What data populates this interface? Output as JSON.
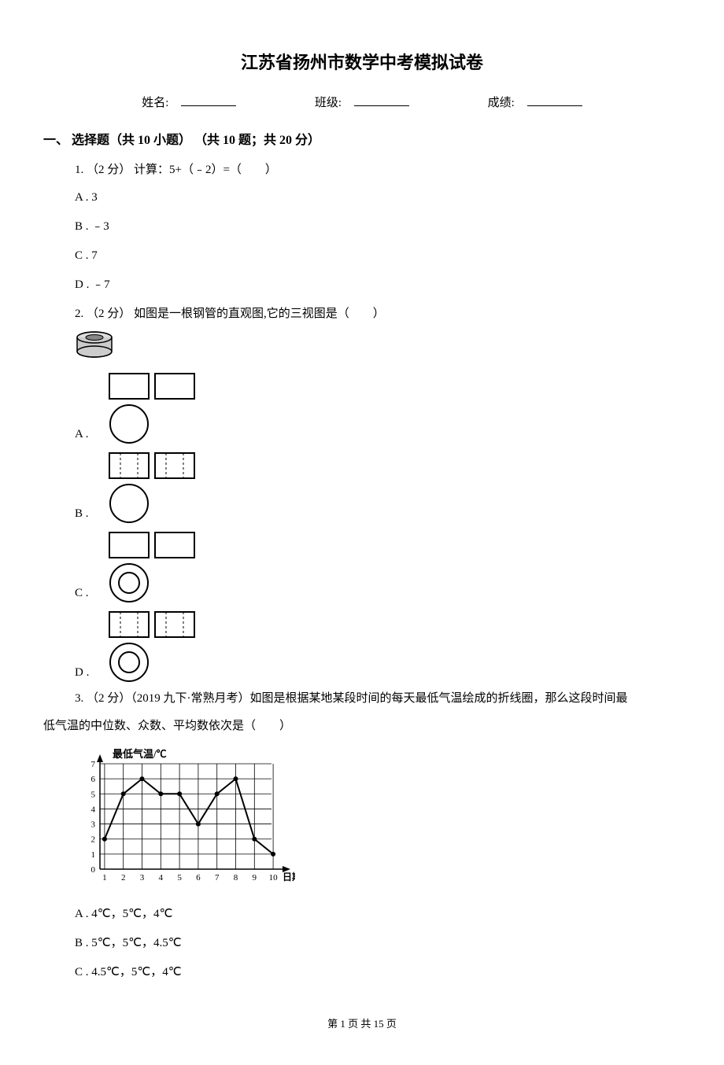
{
  "title": "江苏省扬州市数学中考模拟试卷",
  "header": {
    "name_label": "姓名:",
    "class_label": "班级:",
    "score_label": "成绩:"
  },
  "section1": {
    "heading": "一、 选择题（共 10 小题） （共 10 题；共 20 分）"
  },
  "q1": {
    "text": "1. （2 分） 计算：5+（﹣2）=（　　）",
    "a": "A . 3",
    "b": "B . ﹣3",
    "c": "C . 7",
    "d": "D . ﹣7"
  },
  "q2": {
    "text": "2. （2 分） 如图是一根钢管的直观图,它的三视图是（　　）",
    "a": "A .",
    "b": "B .",
    "c": "C .",
    "d": "D ."
  },
  "q3": {
    "text": "3. （2 分）（2019 九下·常熟月考）如图是根据某地某段时间的每天最低气温绘成的折线圈，那么这段时间最",
    "text_cont": "低气温的中位数、众数、平均数依次是（　　）",
    "a": "A . 4℃，5℃，4℃",
    "b": "B . 5℃，5℃，4.5℃",
    "c": "C . 4.5℃，5℃，4℃"
  },
  "chart_data": {
    "type": "line",
    "title": "",
    "ylabel": "最低气温/℃",
    "xlabel": "日期",
    "x": [
      1,
      2,
      3,
      4,
      5,
      6,
      7,
      8,
      9,
      10
    ],
    "values": [
      2,
      5,
      6,
      5,
      5,
      3,
      5,
      6,
      2,
      1
    ],
    "ylim": [
      0,
      7
    ],
    "y_ticks": [
      0,
      1,
      2,
      3,
      4,
      5,
      6,
      7
    ],
    "grid": true
  },
  "pager": {
    "text": "第 1 页 共 15 页"
  }
}
